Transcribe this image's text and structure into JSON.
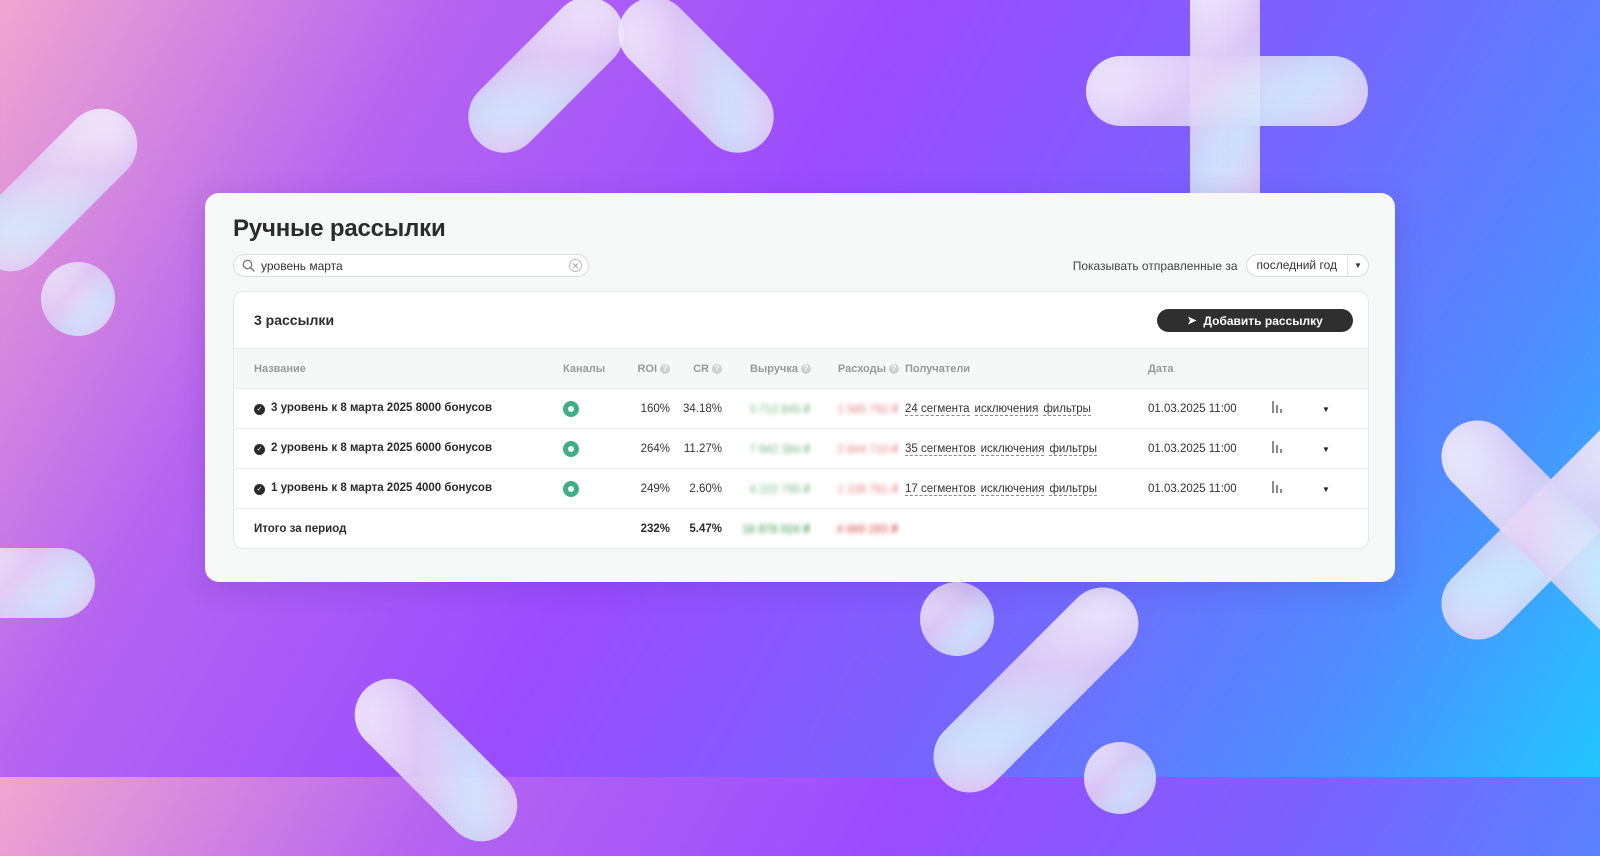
{
  "page": {
    "title": "Ручные рассылки"
  },
  "search": {
    "value": "уровень марта"
  },
  "period": {
    "label": "Показывать отправленные за",
    "selected": "последний год"
  },
  "list": {
    "count_label": "3 рассылки",
    "add_button_label": "Добавить рассылку"
  },
  "table": {
    "headers": {
      "name": "Название",
      "channels": "Каналы",
      "roi": "ROI",
      "cr": "CR",
      "revenue": "Выручка",
      "expenses": "Расходы",
      "recipients": "Получатели",
      "date": "Дата"
    },
    "rows": [
      {
        "name": "3 уровень к 8 марта 2025 8000 бонусов",
        "roi": "160%",
        "cr": "34.18%",
        "revenue": "3 712 845 ₽",
        "expenses": "1 585 792 ₽",
        "segments": "24 сегмента",
        "exclusions": "исключения",
        "filters": "фильтры",
        "date": "01.03.2025 11:00"
      },
      {
        "name": "2 уровень к 8 марта 2025 6000 бонусов",
        "roi": "264%",
        "cr": "11.27%",
        "revenue": "7 942 384 ₽",
        "expenses": "2 844 710 ₽",
        "segments": "35 сегментов",
        "exclusions": "исключения",
        "filters": "фильтры",
        "date": "01.03.2025 11:00"
      },
      {
        "name": "1 уровень к 8 марта 2025 4000 бонусов",
        "roi": "249%",
        "cr": "2.60%",
        "revenue": "4 222 795 ₽",
        "expenses": "1 238 781 ₽",
        "segments": "17 сегментов",
        "exclusions": "исключения",
        "filters": "фильтры",
        "date": "01.03.2025 11:00"
      }
    ],
    "total": {
      "label": "Итого за период",
      "roi": "232%",
      "cr": "5.47%",
      "revenue": "16 878 024 ₽",
      "expenses": "4 869 283 ₽"
    }
  },
  "colors": {
    "channel_green": "#3fae85",
    "button_dark": "#2f2f2f",
    "revenue_green": "#3f9a4e",
    "expenses_red": "#d9534f"
  }
}
